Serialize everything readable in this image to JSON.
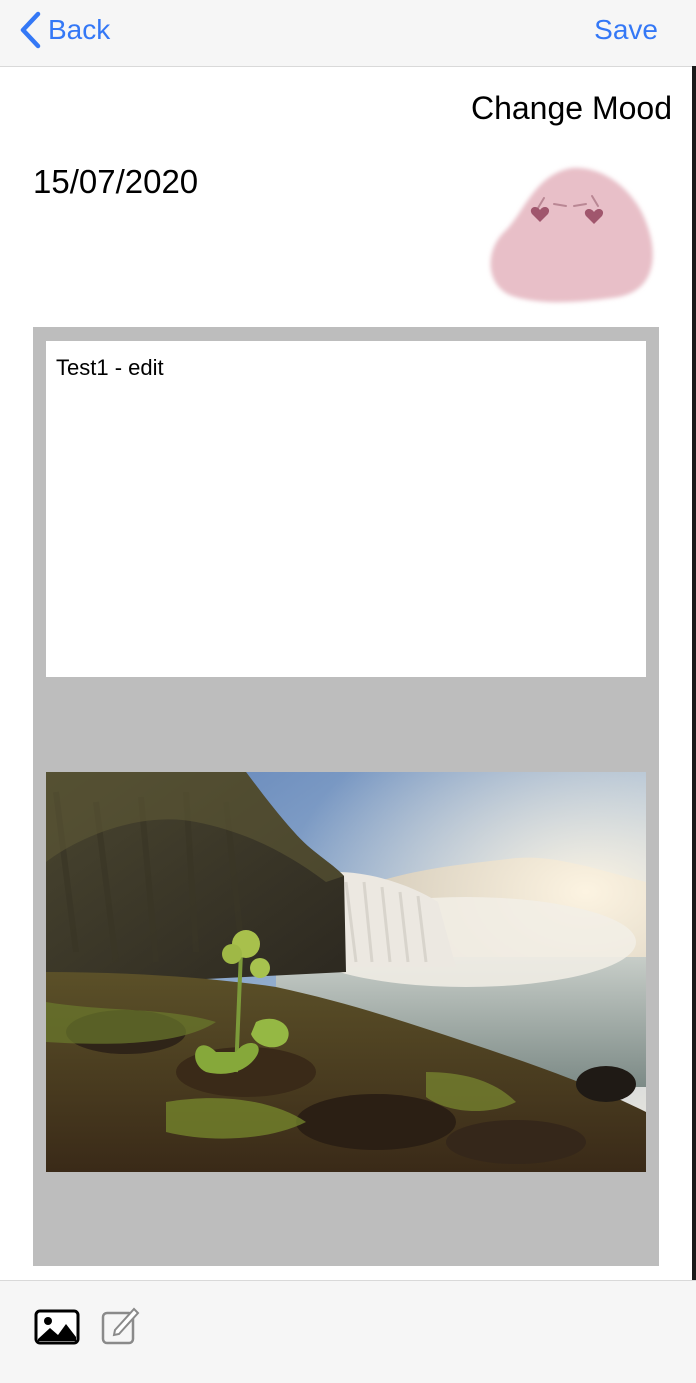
{
  "navbar": {
    "back_label": "Back",
    "save_label": "Save",
    "accent_color": "#3478f6"
  },
  "header": {
    "change_mood_label": "Change Mood",
    "date": "15/07/2020",
    "mood_icon": "pink-blob-face-icon"
  },
  "entry": {
    "text": "Test1 - edit",
    "photo": "waterfall-landscape-photo"
  },
  "toolbar": {
    "items": [
      {
        "icon": "photo-icon"
      },
      {
        "icon": "edit-icon"
      }
    ]
  }
}
